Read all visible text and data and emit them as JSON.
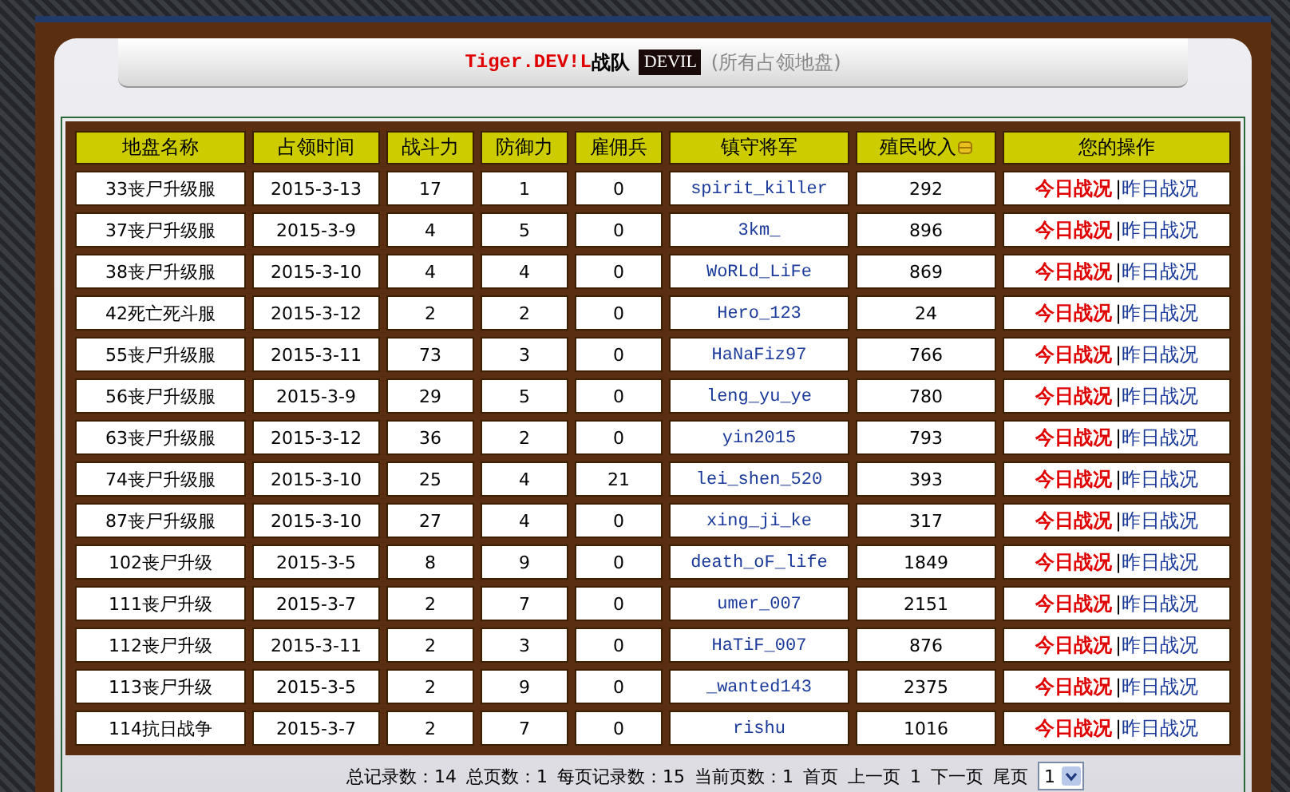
{
  "title": {
    "team": "Tiger.DEV!L",
    "suffix": "战队",
    "logo": "DEVIL",
    "subtitle": "(所有占领地盘)"
  },
  "table": {
    "columns": [
      {
        "label": "地盘名称",
        "kind": "text"
      },
      {
        "label": "占领时间",
        "kind": "text"
      },
      {
        "label": "战斗力",
        "kind": "text"
      },
      {
        "label": "防御力",
        "kind": "text"
      },
      {
        "label": "雇佣兵",
        "kind": "text"
      },
      {
        "label": "镇守将军",
        "kind": "text"
      },
      {
        "label": "殖民收入",
        "kind": "coin"
      },
      {
        "label": "您的操作",
        "kind": "text"
      }
    ],
    "rows": [
      {
        "name": "33丧尸升级服",
        "time": "2015-3-13",
        "attack": "17",
        "defense": "1",
        "mercs": "0",
        "general": "spirit_killer",
        "income": "292",
        "today": "今日战况",
        "sep": "|",
        "yesterday": "昨日战况"
      },
      {
        "name": "37丧尸升级服",
        "time": "2015-3-9",
        "attack": "4",
        "defense": "5",
        "mercs": "0",
        "general": "3km_",
        "income": "896",
        "today": "今日战况",
        "sep": "|",
        "yesterday": "昨日战况"
      },
      {
        "name": "38丧尸升级服",
        "time": "2015-3-10",
        "attack": "4",
        "defense": "4",
        "mercs": "0",
        "general": "WoRLd_LiFe",
        "income": "869",
        "today": "今日战况",
        "sep": "|",
        "yesterday": "昨日战况"
      },
      {
        "name": "42死亡死斗服",
        "time": "2015-3-12",
        "attack": "2",
        "defense": "2",
        "mercs": "0",
        "general": "Hero_123",
        "income": "24",
        "today": "今日战况",
        "sep": "|",
        "yesterday": "昨日战况"
      },
      {
        "name": "55丧尸升级服",
        "time": "2015-3-11",
        "attack": "73",
        "defense": "3",
        "mercs": "0",
        "general": "HaNaFiz97",
        "income": "766",
        "today": "今日战况",
        "sep": "|",
        "yesterday": "昨日战况"
      },
      {
        "name": "56丧尸升级服",
        "time": "2015-3-9",
        "attack": "29",
        "defense": "5",
        "mercs": "0",
        "general": "leng_yu_ye",
        "income": "780",
        "today": "今日战况",
        "sep": "|",
        "yesterday": "昨日战况"
      },
      {
        "name": "63丧尸升级服",
        "time": "2015-3-12",
        "attack": "36",
        "defense": "2",
        "mercs": "0",
        "general": "yin2015",
        "income": "793",
        "today": "今日战况",
        "sep": "|",
        "yesterday": "昨日战况"
      },
      {
        "name": "74丧尸升级服",
        "time": "2015-3-10",
        "attack": "25",
        "defense": "4",
        "mercs": "21",
        "general": "lei_shen_520",
        "income": "393",
        "today": "今日战况",
        "sep": "|",
        "yesterday": "昨日战况"
      },
      {
        "name": "87丧尸升级服",
        "time": "2015-3-10",
        "attack": "27",
        "defense": "4",
        "mercs": "0",
        "general": "xing_ji_ke",
        "income": "317",
        "today": "今日战况",
        "sep": "|",
        "yesterday": "昨日战况"
      },
      {
        "name": "102丧尸升级",
        "time": "2015-3-5",
        "attack": "8",
        "defense": "9",
        "mercs": "0",
        "general": "death_oF_life",
        "income": "1849",
        "today": "今日战况",
        "sep": "|",
        "yesterday": "昨日战况"
      },
      {
        "name": "111丧尸升级",
        "time": "2015-3-7",
        "attack": "2",
        "defense": "7",
        "mercs": "0",
        "general": "umer_007",
        "income": "2151",
        "today": "今日战况",
        "sep": "|",
        "yesterday": "昨日战况"
      },
      {
        "name": "112丧尸升级",
        "time": "2015-3-11",
        "attack": "2",
        "defense": "3",
        "mercs": "0",
        "general": "HaTiF_007",
        "income": "876",
        "today": "今日战况",
        "sep": "|",
        "yesterday": "昨日战况"
      },
      {
        "name": "113丧尸升级",
        "time": "2015-3-5",
        "attack": "2",
        "defense": "9",
        "mercs": "0",
        "general": "_wanted143",
        "income": "2375",
        "today": "今日战况",
        "sep": "|",
        "yesterday": "昨日战况"
      },
      {
        "name": "114抗日战争",
        "time": "2015-3-7",
        "attack": "2",
        "defense": "7",
        "mercs": "0",
        "general": "rishu",
        "income": "1016",
        "today": "今日战况",
        "sep": "|",
        "yesterday": "昨日战况"
      }
    ]
  },
  "pagination": {
    "info": [
      "总记录数：14",
      "总页数：1",
      "每页记录数：15",
      "当前页数：1"
    ],
    "links": [
      "首页",
      "上一页",
      "1",
      "下一页",
      "尾页"
    ],
    "page_select": "1"
  }
}
